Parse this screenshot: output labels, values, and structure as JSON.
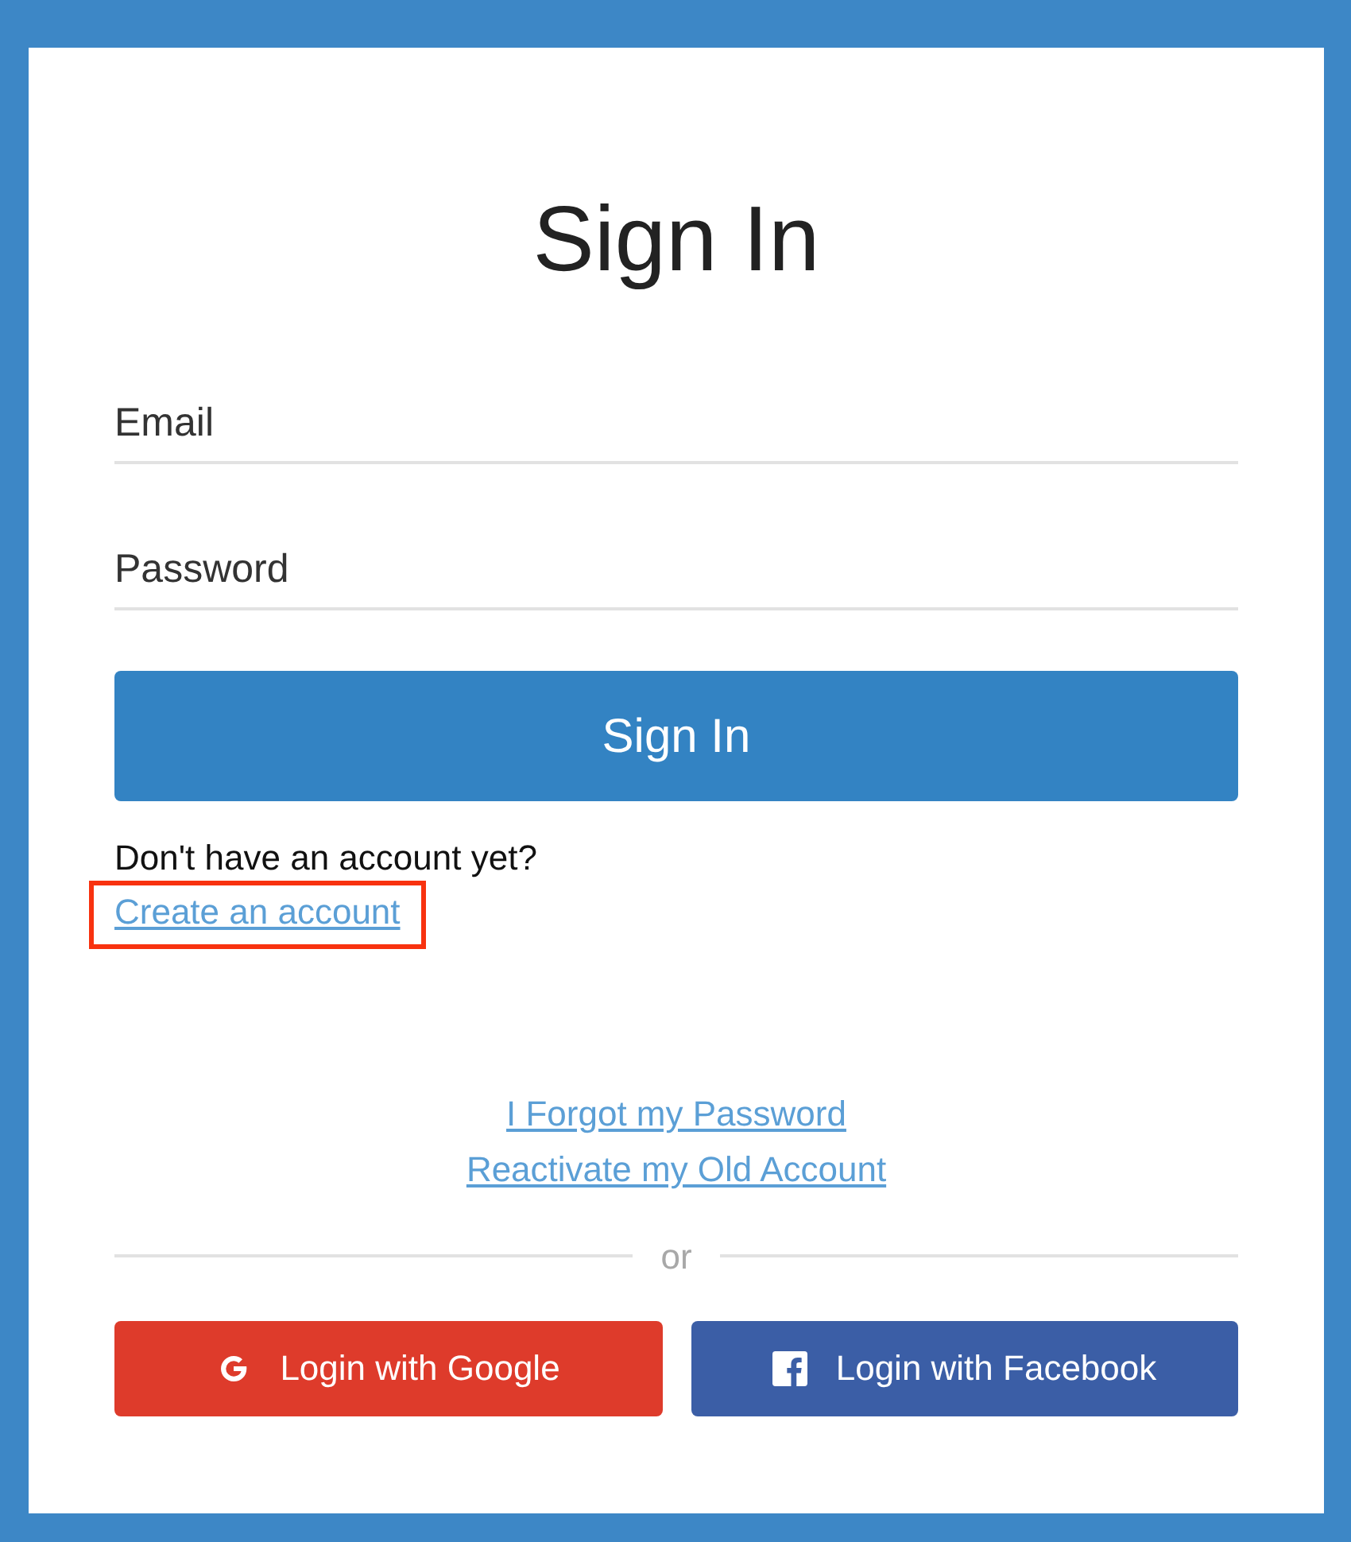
{
  "title": "Sign In",
  "fields": [
    {
      "placeholder": "Email"
    },
    {
      "placeholder": "Password"
    }
  ],
  "submit_button": "Sign In",
  "signup_prompt": "Don't have an account yet?",
  "signup_link": {
    "label": "Create an account",
    "highlighted": true
  },
  "links": [
    "I Forgot my Password",
    "Reactivate my Old Account"
  ],
  "divider_label": "or",
  "social_buttons": [
    {
      "kind": "google",
      "label": "Login with Google"
    },
    {
      "kind": "facebook",
      "label": "Login with Facebook"
    }
  ]
}
